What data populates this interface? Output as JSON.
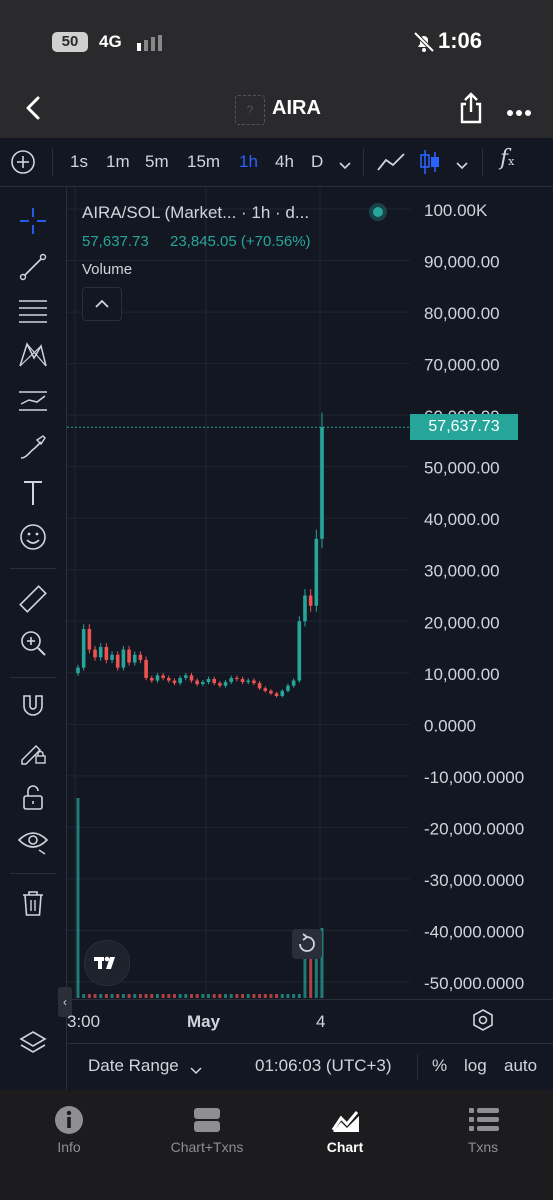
{
  "status_bar": {
    "battery": "50",
    "network": "4G",
    "time": "1:06"
  },
  "header": {
    "title": "AIRA"
  },
  "toolbar": {
    "intervals": [
      "1s",
      "1m",
      "5m",
      "15m",
      "1h",
      "4h",
      "D"
    ],
    "active_interval": "1h",
    "fx_label": "f"
  },
  "chart": {
    "symbol_line": "AIRA/SOL (Market... · 1h · d...",
    "price": "57,637.73",
    "change": "23,845.05 (+70.56%)",
    "volume_label": "Volume",
    "current_price_label": "57,637.73",
    "y_ticks": [
      "100.00K",
      "90,000.00",
      "80,000.00",
      "70,000.00",
      "60,000.00",
      "50,000.00",
      "40,000.00",
      "30,000.00",
      "20,000.00",
      "10,000.00",
      "0.0000",
      "-10,000.0000",
      "-20,000.0000",
      "-30,000.0000",
      "-40,000.0000",
      "-50,000.0000"
    ],
    "x_ticks": [
      "3:00",
      "May",
      "4"
    ],
    "colors": {
      "up": "#26a69a",
      "down": "#ef5350",
      "accent": "#2962ff"
    }
  },
  "chart_data": {
    "type": "candlestick",
    "title": "AIRA/SOL (Market... · 1h · d...",
    "x_ticks": [
      "3:00",
      "May",
      "4"
    ],
    "ylim": [
      -50000,
      100000
    ],
    "last_price": 57637.73,
    "change": 23845.05,
    "change_pct": 70.56,
    "close_series": [
      11000,
      18500,
      14500,
      13000,
      15000,
      12500,
      13500,
      11000,
      14500,
      12000,
      13500,
      12500,
      9000,
      8500,
      9500,
      9000,
      8500,
      8000,
      9000,
      9500,
      8500,
      7800,
      8200,
      8800,
      8000,
      7500,
      8200,
      9000,
      8800,
      8200,
      8500,
      8000,
      7000,
      6500,
      6000,
      5500,
      6500,
      7500,
      8500,
      20000,
      25000,
      23000,
      36000,
      57637.73
    ]
  },
  "footer": {
    "date_range": "Date Range",
    "time": "01:06:03 (UTC+3)",
    "pct": "%",
    "log": "log",
    "auto": "auto"
  },
  "bottom_nav": [
    {
      "label": "Info"
    },
    {
      "label": "Chart+Txns"
    },
    {
      "label": "Chart"
    },
    {
      "label": "Txns"
    }
  ]
}
